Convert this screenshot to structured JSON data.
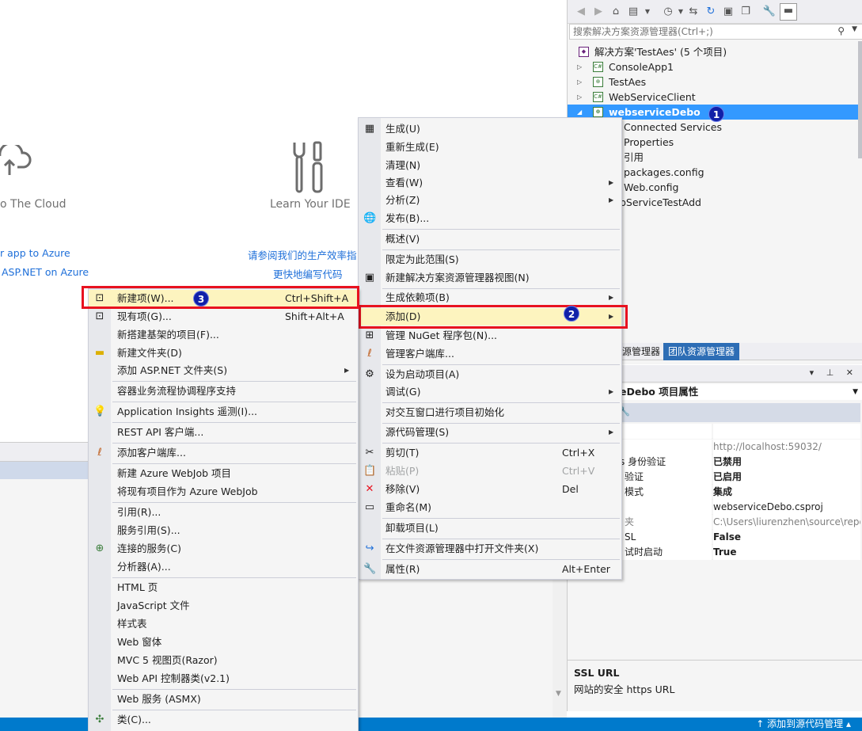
{
  "start_page": {
    "cloud_caption": "o The Cloud",
    "ide_caption": "Learn Your IDE",
    "links_left": [
      "r app to Azure",
      "ASP.NET on Azure"
    ],
    "links_right": [
      "请参阅我们的生产效率指",
      "更快地编写代码"
    ]
  },
  "solution_explorer": {
    "search_placeholder": "搜索解决方案资源管理器(Ctrl+;)",
    "tree": [
      {
        "label": "解决方案'TestAes' (5 个项目)",
        "icon": "solution-icon"
      },
      {
        "label": "ConsoleApp1",
        "icon": "csharp-project-icon"
      },
      {
        "label": "TestAes",
        "icon": "web-project-icon"
      },
      {
        "label": "WebServiceClient",
        "icon": "csharp-project-icon"
      },
      {
        "label": "webserviceDebo",
        "icon": "web-project-icon"
      },
      {
        "label": "Connected Services",
        "icon": "connected-services-icon"
      },
      {
        "label": "Properties",
        "icon": "properties-icon"
      },
      {
        "label": "引用",
        "icon": "references-icon"
      },
      {
        "label": "packages.config",
        "icon": "config-file-icon"
      },
      {
        "label": "Web.config",
        "icon": "config-file-icon"
      },
      {
        "label": "bServiceTestAdd",
        "icon": "service-file-icon"
      }
    ],
    "tabs": [
      "源管理器",
      "团队资源管理器"
    ]
  },
  "properties": {
    "object": "eDebo 项目属性",
    "rows": [
      {
        "name": "",
        "value": ""
      },
      {
        "name": "",
        "value": "http://localhost:59032/"
      },
      {
        "name": "s 身份验证",
        "value": "已禁用"
      },
      {
        "name": "验证",
        "value": "已启用"
      },
      {
        "name": "模式",
        "value": "集成"
      },
      {
        "name": "",
        "value": "webserviceDebo.csproj"
      },
      {
        "name": "夹",
        "value": "C:\\Users\\liurenzhen\\source\\repo"
      },
      {
        "name": "SL",
        "value": "False"
      },
      {
        "name": "试时启动",
        "value": "True"
      }
    ],
    "desc_title": "SSL URL",
    "desc_text": "网站的安全 https URL"
  },
  "context_menu": {
    "items": [
      {
        "label": "生成(U)",
        "icon": "build-icon"
      },
      {
        "label": "重新生成(E)"
      },
      {
        "label": "清理(N)"
      },
      {
        "label": "查看(W)",
        "submenu": true
      },
      {
        "label": "分析(Z)",
        "submenu": true
      },
      {
        "label": "发布(B)...",
        "icon": "publish-globe-icon"
      },
      {
        "label": "概述(V)"
      },
      {
        "label": "限定为此范围(S)"
      },
      {
        "label": "新建解决方案资源管理器视图(N)",
        "icon": "new-view-icon"
      },
      {
        "label": "生成依赖项(B)",
        "submenu": true
      },
      {
        "label": "添加(D)",
        "submenu": true
      },
      {
        "label": "管理 NuGet 程序包(N)...",
        "icon": "nuget-icon"
      },
      {
        "label": "管理客户端库...",
        "icon": "client-library-icon"
      },
      {
        "label": "设为启动项目(A)",
        "icon": "gear-icon"
      },
      {
        "label": "调试(G)",
        "submenu": true
      },
      {
        "label": "对交互窗口进行项目初始化"
      },
      {
        "label": "源代码管理(S)",
        "submenu": true
      },
      {
        "label": "剪切(T)",
        "shortcut": "Ctrl+X",
        "icon": "scissors-icon"
      },
      {
        "label": "粘贴(P)",
        "shortcut": "Ctrl+V",
        "icon": "paste-icon"
      },
      {
        "label": "移除(V)",
        "shortcut": "Del",
        "icon": "remove-x-icon"
      },
      {
        "label": "重命名(M)",
        "icon": "rename-icon"
      },
      {
        "label": "卸载项目(L)"
      },
      {
        "label": "在文件资源管理器中打开文件夹(X)",
        "icon": "open-folder-arrow-icon"
      },
      {
        "label": "属性(R)",
        "shortcut": "Alt+Enter",
        "icon": "wrench-icon"
      }
    ]
  },
  "add_submenu": {
    "items": [
      {
        "label": "新建项(W)...",
        "shortcut": "Ctrl+Shift+A",
        "icon": "new-item-icon"
      },
      {
        "label": "现有项(G)...",
        "shortcut": "Shift+Alt+A",
        "icon": "existing-item-icon"
      },
      {
        "label": "新搭建基架的项目(F)..."
      },
      {
        "label": "新建文件夹(D)",
        "icon": "new-folder-icon"
      },
      {
        "label": "添加 ASP.NET 文件夹(S)",
        "submenu": true
      },
      {
        "label": "容器业务流程协调程序支持"
      },
      {
        "label": "Application Insights 遥测(I)...",
        "icon": "app-insights-icon"
      },
      {
        "label": "REST API 客户端..."
      },
      {
        "label": "添加客户端库...",
        "icon": "client-library-icon"
      },
      {
        "label": "新建 Azure WebJob 项目"
      },
      {
        "label": "将现有项目作为 Azure WebJob"
      },
      {
        "label": "引用(R)..."
      },
      {
        "label": "服务引用(S)..."
      },
      {
        "label": "连接的服务(C)",
        "icon": "connected-service-icon"
      },
      {
        "label": "分析器(A)..."
      },
      {
        "label": "HTML 页"
      },
      {
        "label": "JavaScript 文件"
      },
      {
        "label": "样式表"
      },
      {
        "label": "Web 窗体"
      },
      {
        "label": "MVC 5 视图页(Razor)"
      },
      {
        "label": "Web API 控制器类(v2.1)"
      },
      {
        "label": "Web 服务 (ASMX)"
      },
      {
        "label": "类(C)...",
        "icon": "class-icon"
      }
    ]
  },
  "badges": [
    "1",
    "2",
    "3"
  ],
  "statusbar": {
    "source_control": "添加到源代码管理"
  },
  "colors": {
    "accent": "#007acc",
    "selection": "#3399ff",
    "highlight_box": "#e8121f",
    "badge": "#1020a8"
  }
}
